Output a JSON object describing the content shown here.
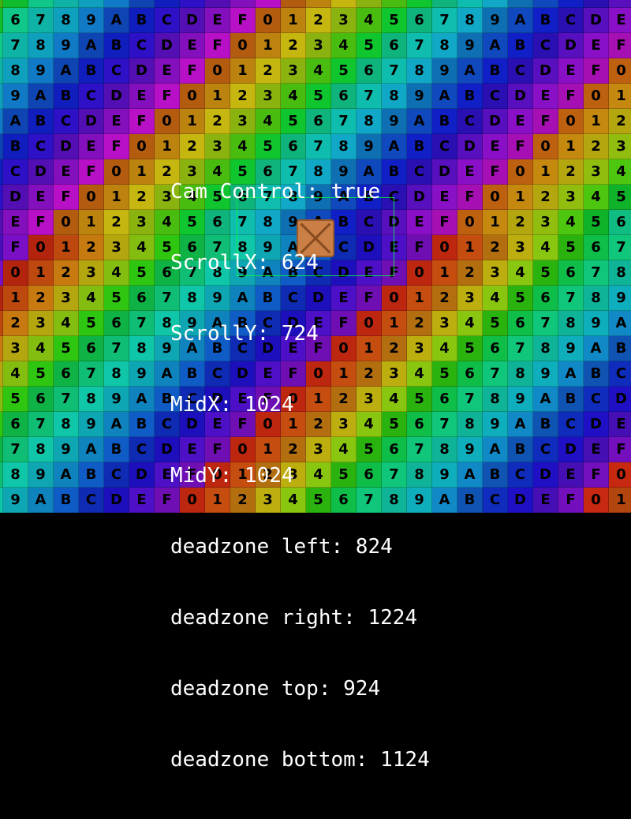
{
  "camera_debug": {
    "cam_control": "Cam Control: true",
    "scroll_x": "ScrollX: 624",
    "scroll_y": "ScrollY: 724",
    "mid_x": "MidX: 1024",
    "mid_y": "MidY: 1024",
    "deadzone_left": "deadzone left: 824",
    "deadzone_right": "deadzone right: 1224",
    "deadzone_top": "deadzone top: 924",
    "deadzone_bottom": "deadzone bottom: 1124"
  },
  "tile_glyphs": [
    "0",
    "1",
    "2",
    "3",
    "4",
    "5",
    "6",
    "7",
    "8",
    "9",
    "A",
    "B",
    "C",
    "D",
    "E",
    "F"
  ],
  "colors": {
    "deadzone_outline": "#00ff3c",
    "player_sprite": "#c97f45",
    "hud_text": "#ffffff"
  }
}
